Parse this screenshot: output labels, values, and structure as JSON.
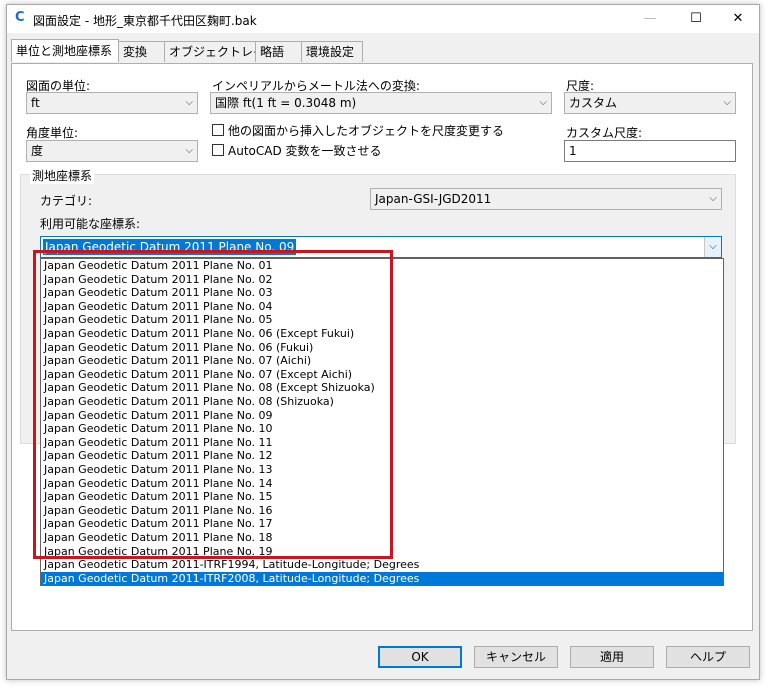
{
  "window": {
    "title": "図面設定 - 地形_東京都千代田区麹町.bak",
    "app_icon": "C",
    "min": "—",
    "max": "☐",
    "close": "✕"
  },
  "tabs": [
    "単位と測地座標系",
    "変換",
    "オブジェクトレイヤ",
    "略語",
    "環境設定"
  ],
  "units": {
    "drawing_unit_label": "図面の単位:",
    "drawing_unit_value": "ft",
    "imperial_label": "インペリアルからメートル法への変換:",
    "imperial_value": "国際 ft(1 ft = 0.3048 m)",
    "scale_label": "尺度:",
    "scale_value": "カスタム",
    "angle_label": "角度単位:",
    "angle_value": "度",
    "scale_objects_label": "他の図面から挿入したオブジェクトを尺度変更する",
    "autocad_vars_label": "AutoCAD 変数を一致させる",
    "custom_scale_label": "カスタム尺度:",
    "custom_scale_value": "1"
  },
  "coordinate_system": {
    "group_label": "測地座標系",
    "category_label": "カテゴリ:",
    "category_value": "Japan-GSI-JGD2011",
    "available_label": "利用可能な座標系:",
    "selected_value": "Japan Geodetic Datum 2011 Plane No. 09",
    "items": [
      "Japan Geodetic Datum 2011 Plane No. 01",
      "Japan Geodetic Datum 2011 Plane No. 02",
      "Japan Geodetic Datum 2011 Plane No. 03",
      "Japan Geodetic Datum 2011 Plane No. 04",
      "Japan Geodetic Datum 2011 Plane No. 05",
      "Japan Geodetic Datum 2011 Plane No. 06 (Except Fukui)",
      "Japan Geodetic Datum 2011 Plane No. 06 (Fukui)",
      "Japan Geodetic Datum 2011 Plane No. 07 (Aichi)",
      "Japan Geodetic Datum 2011 Plane No. 07 (Except Aichi)",
      "Japan Geodetic Datum 2011 Plane No. 08 (Except Shizuoka)",
      "Japan Geodetic Datum 2011 Plane No. 08 (Shizuoka)",
      "Japan Geodetic Datum 2011 Plane No. 09",
      "Japan Geodetic Datum 2011 Plane No. 10",
      "Japan Geodetic Datum 2011 Plane No. 11",
      "Japan Geodetic Datum 2011 Plane No. 12",
      "Japan Geodetic Datum 2011 Plane No. 13",
      "Japan Geodetic Datum 2011 Plane No. 14",
      "Japan Geodetic Datum 2011 Plane No. 15",
      "Japan Geodetic Datum 2011 Plane No. 16",
      "Japan Geodetic Datum 2011 Plane No. 17",
      "Japan Geodetic Datum 2011 Plane No. 18",
      "Japan Geodetic Datum 2011 Plane No. 19",
      "Japan Geodetic Datum 2011-ITRF1994, Latitude-Longitude; Degrees",
      "Japan Geodetic Datum 2011-ITRF2008, Latitude-Longitude; Degrees"
    ],
    "highlighted_item": "Japan Geodetic Datum 2011-ITRF2008, Latitude-Longitude; Degrees"
  },
  "buttons": {
    "ok": "OK",
    "cancel": "キャンセル",
    "apply": "適用",
    "help": "ヘルプ"
  },
  "colors": {
    "selection": "#0078d7",
    "highlight_box": "#d0121b"
  },
  "icons": {
    "dropdown_arrow": "⌵"
  }
}
